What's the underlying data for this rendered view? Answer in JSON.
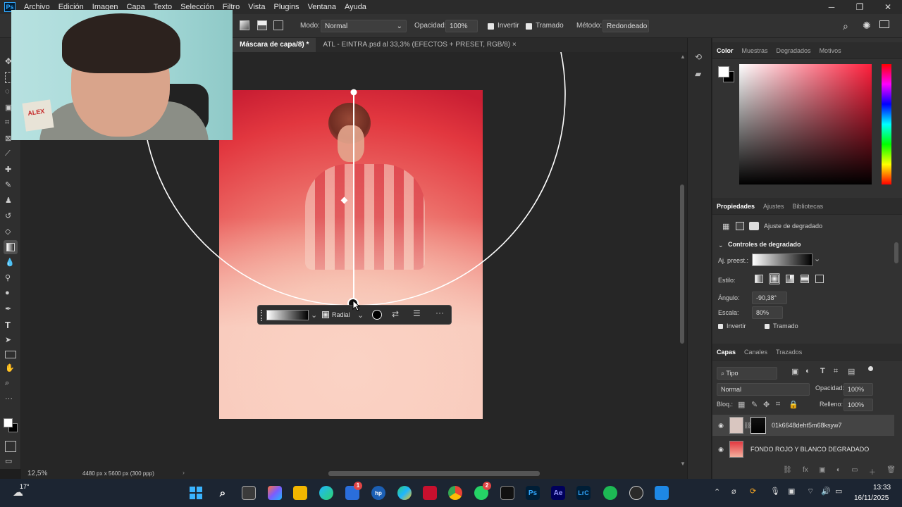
{
  "menubar": {
    "logo": "Ps",
    "items": [
      "Archivo",
      "Edición",
      "Imagen",
      "Capa",
      "Texto",
      "Selección",
      "Filtro",
      "Vista",
      "Plugins",
      "Ventana",
      "Ayuda"
    ]
  },
  "window_controls": {
    "minimize": "─",
    "restore": "❐",
    "close": "✕"
  },
  "options": {
    "mode_label": "Modo:",
    "mode_value": "Normal",
    "opacity_label": "Opacidad:",
    "opacity_value": "100%",
    "invert_label": "Invertir",
    "dither_label": "Tramado",
    "method_label": "Método:",
    "method_value": "Redondeado"
  },
  "tabs": [
    {
      "label": "Máscara de capa/8) *"
    },
    {
      "label": "ATL - EINTRA.psd al 33,3% (EFECTOS + PRESET, RGB/8)"
    }
  ],
  "tab_close": "×",
  "gradient_toolbar": {
    "type_value": "Radial"
  },
  "status": {
    "zoom": "12,5%",
    "doc_info": "4480 px x 5600 px (300 ppp)"
  },
  "color_panel": {
    "tabs": [
      "Color",
      "Muestras",
      "Degradados",
      "Motivos"
    ],
    "colors": {
      "hue": "#ff1f3c",
      "fg": "#ffffff",
      "bg": "#000000"
    }
  },
  "properties_panel": {
    "tabs": [
      "Propiedades",
      "Ajustes",
      "Bibliotecas"
    ],
    "subtitle": "Ajuste de degradado",
    "section": "Controles de degradado",
    "preset_label": "Aj. preest.:",
    "style_label": "Estilo:",
    "angle_label": "Ángulo:",
    "angle_value": "-90,38°",
    "scale_label": "Escala:",
    "scale_value": "80%",
    "invert_label": "Invertir",
    "dither_label": "Tramado"
  },
  "layers_panel": {
    "tabs": [
      "Capas",
      "Canales",
      "Trazados"
    ],
    "filter_value": "Tipo",
    "blend_value": "Normal",
    "opacity_label": "Opacidad:",
    "opacity_value": "100%",
    "lock_label": "Bloq.:",
    "fill_label": "Relleno:",
    "fill_value": "100%",
    "layers": [
      {
        "name": "01k6648deht5m68ksyw7"
      },
      {
        "name": "FONDO ROJO Y BLANCO DEGRADADO"
      }
    ]
  },
  "taskbar": {
    "weather_temp": "17°",
    "time": "13:33",
    "date": "16/11/2025",
    "apps": [
      "Ps",
      "Ae",
      "LrC"
    ],
    "badges": {
      "store": "1",
      "whatsapp": "2"
    }
  },
  "webcam_text": "ALEX"
}
